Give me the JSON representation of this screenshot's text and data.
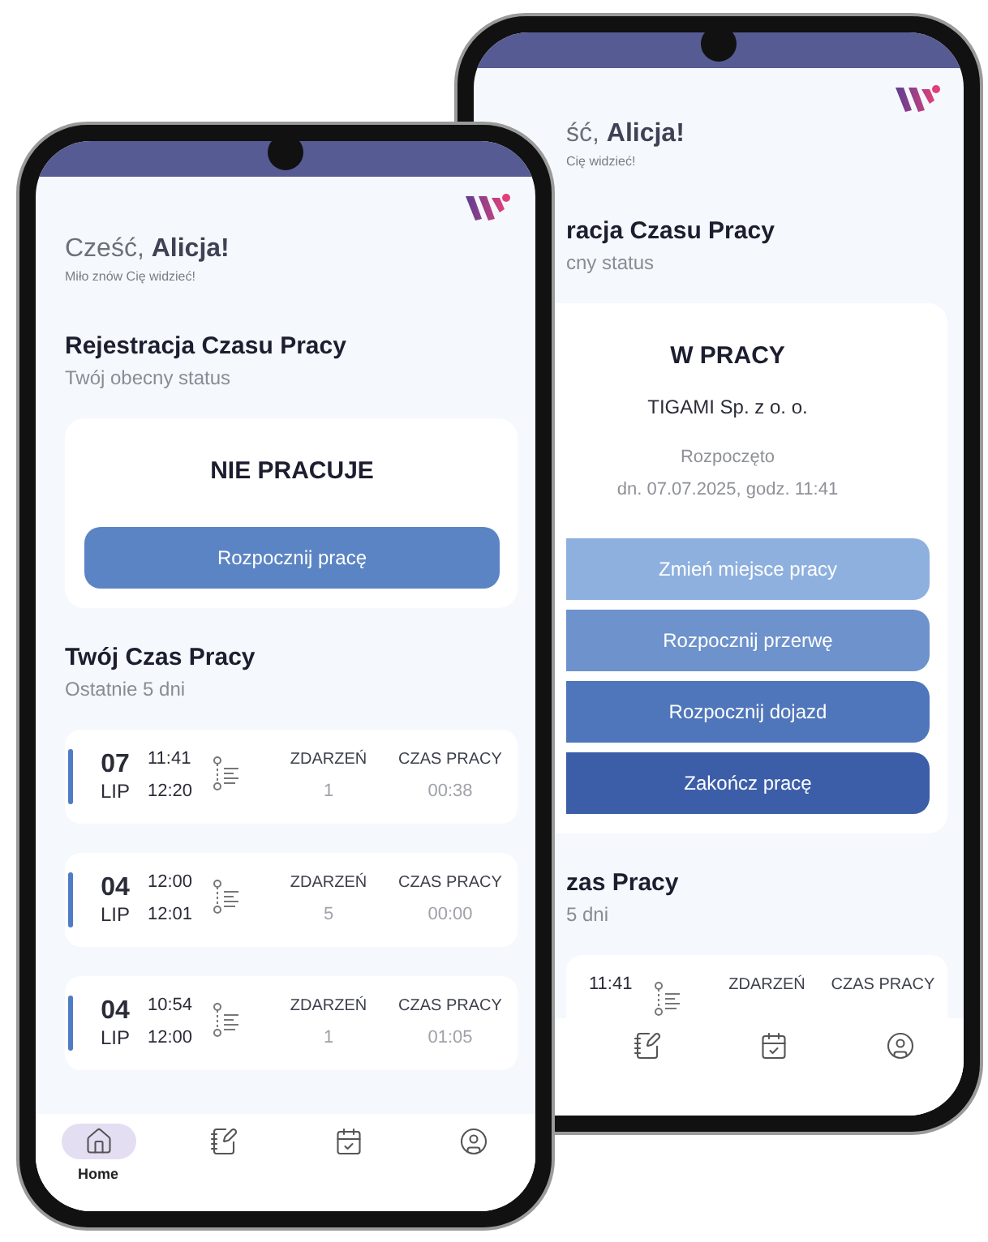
{
  "back_phone": {
    "greeting": "ść, **Alicja!**",
    "greeting_sub": "Cię widzieć!",
    "section_title": "racja Czasu Pracy",
    "section_subtitle": "cny status",
    "status": {
      "title": "W PRACY",
      "company": "TIGAMI Sp. z o. o.",
      "started_label": "Rozpoczęto",
      "started_at": "dn. 07.07.2025, godz. 11:41",
      "actions": [
        {
          "label": "Zmień miejsce pracy",
          "color": "#8eb0de"
        },
        {
          "label": "Rozpocznij przerwę",
          "color": "#6d92cc"
        },
        {
          "label": "Rozpocznij dojazd",
          "color": "#4f76ba"
        },
        {
          "label": "Zakończ pracę",
          "color": "#3c5ea8"
        }
      ]
    },
    "history_title": "zas Pracy",
    "history_subtitle": "5 dni",
    "entries": [
      {
        "start": "11:41",
        "events_label": "ZDARZEŃ",
        "time_label": "CZAS PRACY"
      }
    ],
    "nav": [
      {
        "kind": "journal",
        "selected": false
      },
      {
        "kind": "calendar",
        "selected": false
      },
      {
        "kind": "profile",
        "selected": false
      }
    ]
  },
  "front_phone": {
    "greeting": "Cześć, **Alicja!**",
    "greeting_sub": "Miło znów Cię widzieć!",
    "section_title": "Rejestracja Czasu Pracy",
    "section_subtitle": "Twój obecny status",
    "status": {
      "title": "NIE PRACUJE",
      "actions": [
        {
          "label": "Rozpocznij pracę",
          "color": "#5b84c4"
        }
      ]
    },
    "history_title": "Twój Czas Pracy",
    "history_subtitle": "Ostatnie 5 dni",
    "entries": [
      {
        "day": "07",
        "month": "LIP",
        "start": "11:41",
        "end": "12:20",
        "events_label": "ZDARZEŃ",
        "events": "1",
        "time_label": "CZAS PRACY",
        "time": "00:38"
      },
      {
        "day": "04",
        "month": "LIP",
        "start": "12:00",
        "end": "12:01",
        "events_label": "ZDARZEŃ",
        "events": "5",
        "time_label": "CZAS PRACY",
        "time": "00:00"
      },
      {
        "day": "04",
        "month": "LIP",
        "start": "10:54",
        "end": "12:00",
        "events_label": "ZDARZEŃ",
        "events": "1",
        "time_label": "CZAS PRACY",
        "time": "01:05"
      }
    ],
    "nav": [
      {
        "kind": "home",
        "label": "Home",
        "selected": true
      },
      {
        "kind": "journal",
        "selected": false
      },
      {
        "kind": "calendar",
        "selected": false
      },
      {
        "kind": "profile",
        "selected": false
      }
    ]
  }
}
